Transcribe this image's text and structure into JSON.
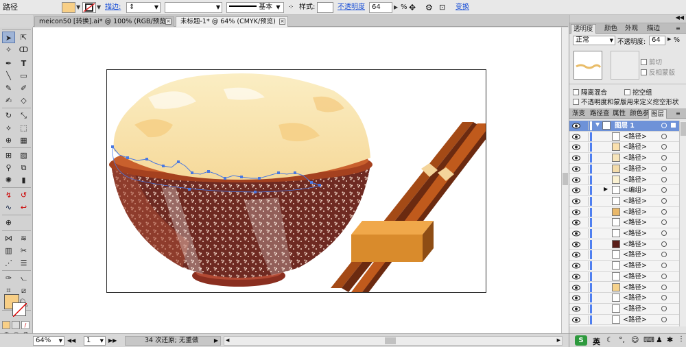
{
  "control_bar": {
    "object_type": "路径",
    "stroke_label": "描边:",
    "stroke_profile": "基本",
    "style_label": "样式:",
    "opacity_label": "不透明度",
    "opacity_value": "64",
    "opacity_unit": "%",
    "transform_label": "变换",
    "fill_color": "#f8cf86"
  },
  "document_tabs": [
    {
      "label": "meicon50 [转换].ai* @ 100% (RGB/预览)"
    },
    {
      "label": "未标题-1* @ 64% (CMYK/预览)"
    }
  ],
  "status_bar": {
    "zoom": "64%",
    "artboard_number": "1",
    "undo_status": "34 次还原; 无重做"
  },
  "transparency_panel": {
    "tabs": [
      "透明度",
      "颜色",
      "外观",
      "描边"
    ],
    "blend_mode": "正常",
    "opacity_label": "不透明度:",
    "opacity_value": "64",
    "opacity_unit": "%",
    "clip_label": "剪切",
    "invert_mask_label": "反相蒙版",
    "isolate_blending_label": "隔离混合",
    "knockout_group_label": "挖空组",
    "opacity_mask_label": "不透明度和蒙版用来定义挖空形状"
  },
  "layers_panel": {
    "tabs": [
      "渐变",
      "路径查",
      "属性",
      "颜色参",
      "图层"
    ],
    "layer_name": "图层 1",
    "items": [
      {
        "label": "<路径>",
        "thumb": "#ffffff"
      },
      {
        "label": "<路径>",
        "thumb": "#fae0ad"
      },
      {
        "label": "<路径>",
        "thumb": "#f7e5bb"
      },
      {
        "label": "<路径>",
        "thumb": "#f4dcaa"
      },
      {
        "label": "<路径>",
        "thumb": "#fbf2d2"
      },
      {
        "label": "<编组>",
        "thumb": "#ffffff"
      },
      {
        "label": "<路径>",
        "thumb": "#ffffff"
      },
      {
        "label": "<路径>",
        "thumb": "#e9b86a"
      },
      {
        "label": "<路径>",
        "thumb": "#ffffff"
      },
      {
        "label": "<路径>",
        "thumb": "#ffffff"
      },
      {
        "label": "<路径>",
        "thumb": "#5a1f1a"
      },
      {
        "label": "<路径>",
        "thumb": "#ffffff"
      },
      {
        "label": "<路径>",
        "thumb": "#ffffff"
      },
      {
        "label": "<路径>",
        "thumb": "#ffffff"
      },
      {
        "label": "<路径>",
        "thumb": "#f6d28b"
      },
      {
        "label": "<路径>",
        "thumb": "#ffffff"
      },
      {
        "label": "<路径>",
        "thumb": "#ffffff"
      },
      {
        "label": "<路径>",
        "thumb": "#ffffff"
      }
    ]
  },
  "ime_indicator": "英"
}
